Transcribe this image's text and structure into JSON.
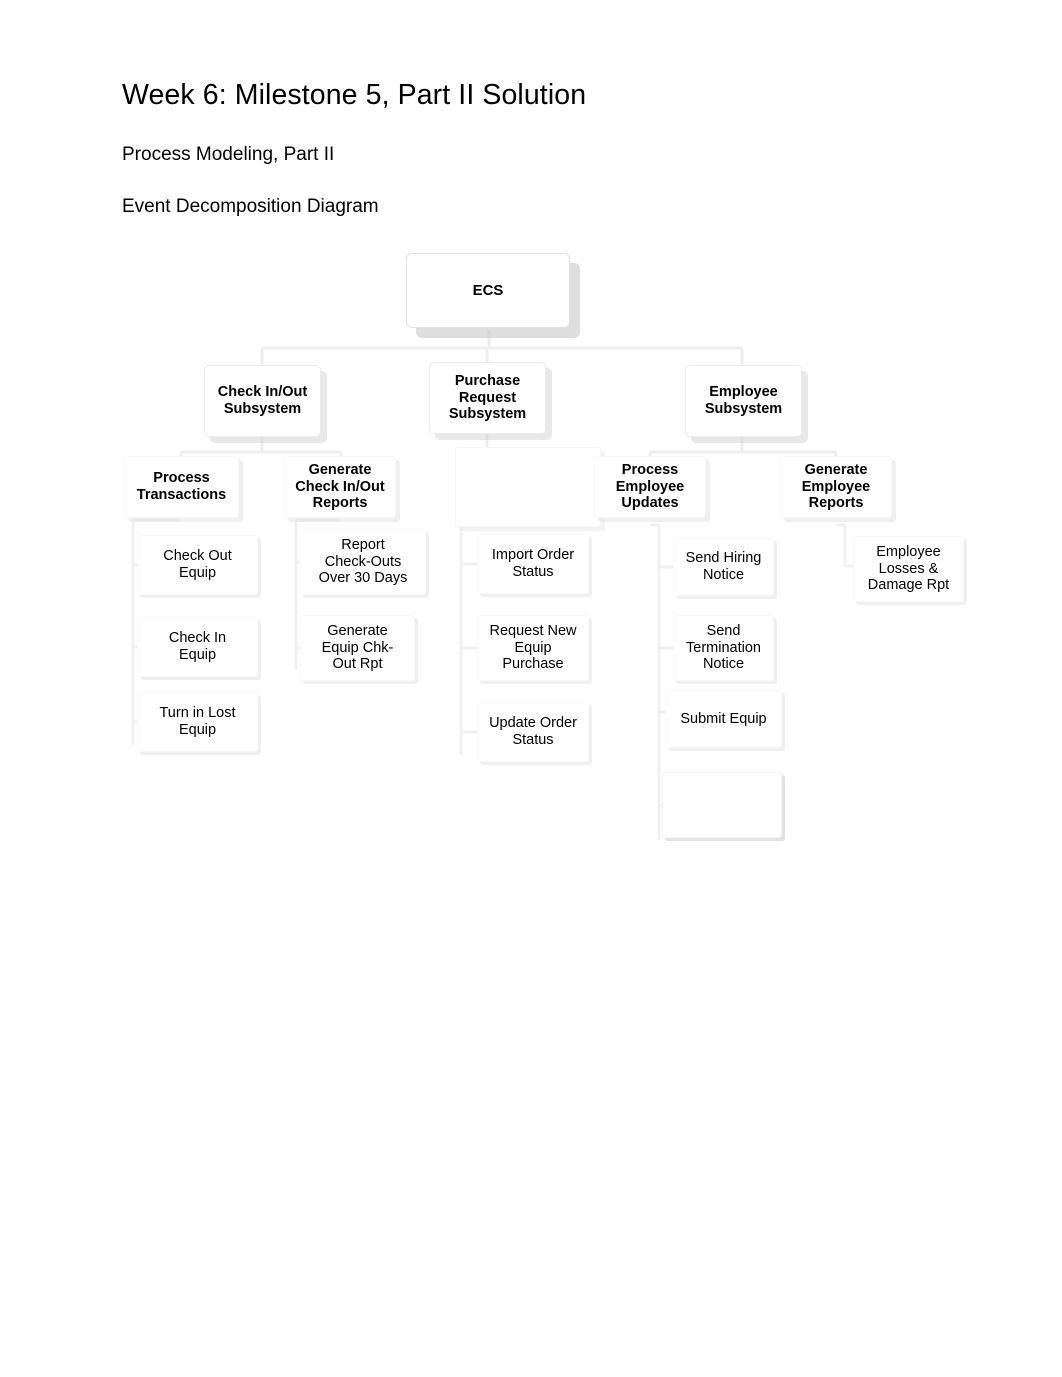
{
  "document": {
    "title": "Week 6: Milestone 5, Part II Solution",
    "subtitle_1": "Process Modeling, Part II",
    "subtitle_2": "Event Decomposition Diagram"
  },
  "footer": {
    "rule_color": "#c0b0b0"
  },
  "diagram": {
    "type": "event-decomposition-tree",
    "root": {
      "label": "ECS"
    },
    "subsystems": [
      {
        "label": "Check In/Out\nSubsystem"
      },
      {
        "label": "Purchase\nRequest\nSubsystem"
      },
      {
        "label": "Employee\nSubsystem"
      }
    ],
    "groups": [
      {
        "label": "Process\nTransactions"
      },
      {
        "label": "Generate\nCheck In/Out\nReports"
      },
      {
        "label": ""
      },
      {
        "label": "Process\nEmployee\nUpdates"
      },
      {
        "label": "Generate\nEmployee\nReports"
      }
    ],
    "events": [
      {
        "label": "Check Out\nEquip"
      },
      {
        "label": "Check In\nEquip"
      },
      {
        "label": "Turn in Lost\nEquip"
      },
      {
        "label": "Report\nCheck-Outs\nOver 30 Days"
      },
      {
        "label": "Generate\nEquip Chk-\nOut Rpt"
      },
      {
        "label": "Import Order\nStatus"
      },
      {
        "label": "Request New\nEquip\nPurchase"
      },
      {
        "label": "Update Order\nStatus"
      },
      {
        "label": "Send Hiring\nNotice"
      },
      {
        "label": "Send\nTermination\nNotice"
      },
      {
        "label": "Submit Equip"
      },
      {
        "label": "Employee\nLosses &\nDamage Rpt"
      }
    ],
    "ghost_nodes": [
      {
        "label": ""
      }
    ]
  }
}
